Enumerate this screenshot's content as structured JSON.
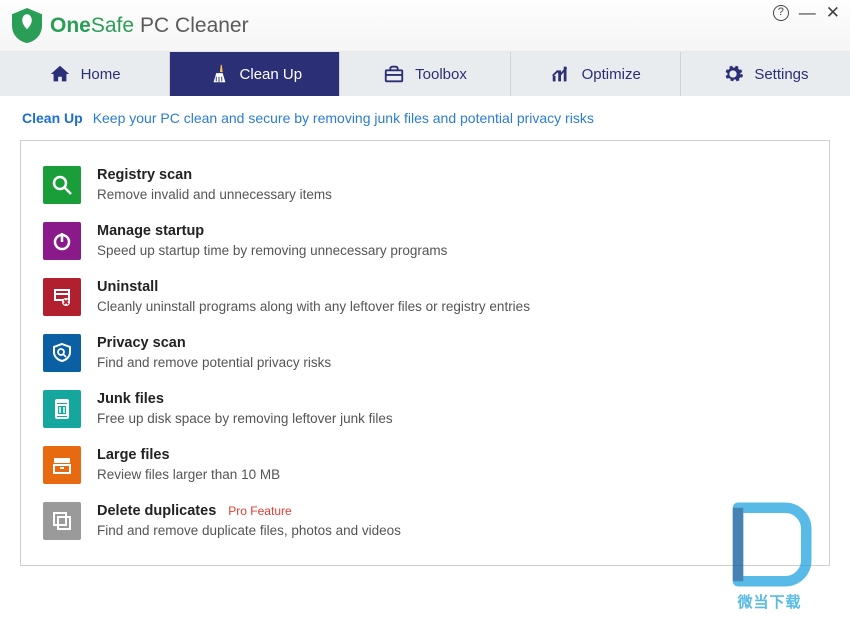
{
  "app": {
    "brand_one": "One",
    "brand_safe": "Safe",
    "brand_rest": "PC Cleaner"
  },
  "window": {
    "help": "?",
    "min": "—",
    "close": "✕"
  },
  "tabs": [
    {
      "id": "home",
      "label": "Home",
      "active": false
    },
    {
      "id": "cleanup",
      "label": "Clean Up",
      "active": true
    },
    {
      "id": "toolbox",
      "label": "Toolbox",
      "active": false
    },
    {
      "id": "optimize",
      "label": "Optimize",
      "active": false
    },
    {
      "id": "settings",
      "label": "Settings",
      "active": false
    }
  ],
  "sub": {
    "title": "Clean Up",
    "desc": "Keep your PC clean and secure by removing junk files and potential privacy risks"
  },
  "items": [
    {
      "id": "registry",
      "color": "#1a9e3a",
      "title": "Registry scan",
      "desc": "Remove invalid and unnecessary items"
    },
    {
      "id": "startup",
      "color": "#8a1a8a",
      "title": "Manage startup",
      "desc": "Speed up startup time by removing unnecessary programs"
    },
    {
      "id": "uninstall",
      "color": "#b21f2e",
      "title": "Uninstall",
      "desc": "Cleanly uninstall programs along with any leftover files or registry entries"
    },
    {
      "id": "privacy",
      "color": "#0a60a3",
      "title": "Privacy scan",
      "desc": "Find and remove potential privacy risks"
    },
    {
      "id": "junk",
      "color": "#15a69e",
      "title": "Junk files",
      "desc": "Free up disk space by removing leftover junk files"
    },
    {
      "id": "large",
      "color": "#e86a10",
      "title": "Large files",
      "desc": "Review files larger than 10 MB"
    },
    {
      "id": "duplicates",
      "color": "#9a9a9a",
      "title": "Delete duplicates",
      "desc": "Find and remove duplicate files, photos and videos",
      "badge": "Pro Feature"
    }
  ],
  "watermark": {
    "caption": "微当下载"
  }
}
